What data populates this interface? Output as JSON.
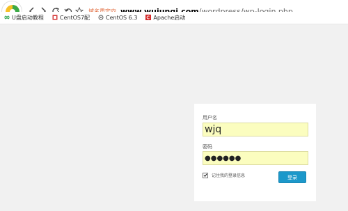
{
  "browser": {
    "redirect_label": "域名重定向",
    "url_host": "www.wujunqi.com",
    "url_path": "/wordpress/wp-login.php"
  },
  "bookmarks": [
    {
      "label": "U盘启动教程",
      "icon": "loop-icon",
      "color": "#2aa24a"
    },
    {
      "label": "CentOS7配",
      "icon": "centos-icon",
      "color": "#d43a3a"
    },
    {
      "label": "CentOS 6.3",
      "icon": "gear-icon",
      "color": "#555555"
    },
    {
      "label": "Apache启动",
      "icon": "c-icon",
      "color": "#d52b2b"
    }
  ],
  "login": {
    "username_label": "用户名",
    "username_value": "wjq",
    "password_label": "密码",
    "password_value": "●●●●●●",
    "remember_label": "记住我的登录信息",
    "remember_checked": true,
    "submit_label": "登录"
  },
  "colors": {
    "accent": "#1c98ca",
    "autofill": "#fbfdbf",
    "page_bg": "#f1f1f1"
  }
}
